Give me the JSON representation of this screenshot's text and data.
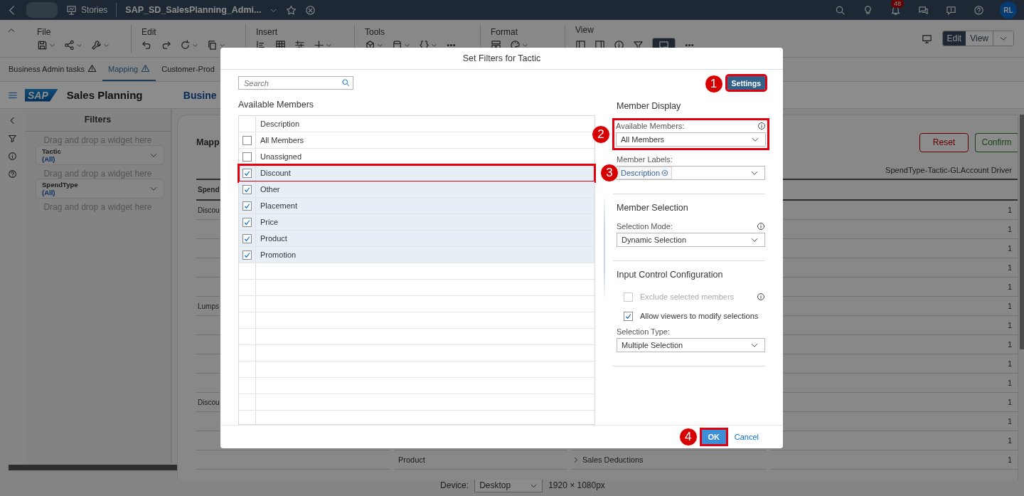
{
  "shell": {
    "section": "Stories",
    "title": "SAP_SD_SalesPlanning_Admi...",
    "notification_count": "48",
    "avatar": "RL"
  },
  "toolbar": {
    "groups": [
      "File",
      "Edit",
      "Insert",
      "Tools",
      "Format",
      "View"
    ],
    "modes": [
      {
        "label": "Edit",
        "selected": true
      },
      {
        "label": "View",
        "selected": false
      }
    ]
  },
  "page_tabs": [
    {
      "label": "Business Admin tasks",
      "selected": false,
      "warning": true
    },
    {
      "label": "Mapping",
      "selected": true,
      "warning": true
    },
    {
      "label": "Customer-Prod",
      "selected": false,
      "warning": false
    }
  ],
  "header": {
    "logo": "SAP",
    "app_title": "Sales Planning",
    "page_title": "Busine"
  },
  "filters": {
    "title": "Filters",
    "items": [
      {
        "kind": "hint",
        "text": "Drag and drop a widget here"
      },
      {
        "kind": "filter",
        "label": "Tactic",
        "value": "(All)"
      },
      {
        "kind": "hint",
        "text": "Drag and drop a widget here"
      },
      {
        "kind": "filter",
        "label": "SpendType",
        "value": "(All)"
      },
      {
        "kind": "hint",
        "text": "Drag and drop a widget here"
      }
    ]
  },
  "content": {
    "title": "Mapp",
    "buttons": [
      {
        "label": "Reset",
        "kind": "reset"
      },
      {
        "label": "Confirm",
        "kind": "confirm"
      }
    ],
    "driver_header": "SpendType-Tactic-GLAccount Driver",
    "column_header": "Spend",
    "rows": [
      {
        "column_1": "Discou",
        "value": "1"
      },
      {
        "value": "1"
      },
      {
        "value": "1"
      },
      {
        "value": "1"
      },
      {
        "value": "1"
      },
      {
        "column_1": "Lumps",
        "value": "1"
      },
      {
        "value": "1"
      },
      {
        "value": "1"
      },
      {
        "value": "1"
      },
      {
        "value": "1"
      },
      {
        "column_1": "Discou",
        "value": "1"
      },
      {
        "value": "1"
      },
      {
        "value": "1"
      },
      {
        "column_2": "Product",
        "column_3": "Sales Deductions",
        "value": "1"
      }
    ]
  },
  "device_bar": {
    "label": "Device:",
    "device": "Desktop",
    "resolution": "1920 × 1080px"
  },
  "dialog": {
    "title": "Set Filters for Tactic",
    "search": {
      "placeholder": "Search"
    },
    "settings": {
      "label": "Settings",
      "callout": "1"
    },
    "members_title": "Available Members",
    "column": "Description",
    "members": [
      {
        "label": "All Members",
        "checked": false
      },
      {
        "label": "Unassigned",
        "checked": false
      },
      {
        "label": "Discount",
        "checked": true,
        "callout": "3"
      },
      {
        "label": "Other",
        "checked": true
      },
      {
        "label": "Placement",
        "checked": true
      },
      {
        "label": "Price",
        "checked": true
      },
      {
        "label": "Product",
        "checked": true
      },
      {
        "label": "Promotion",
        "checked": true
      }
    ],
    "sections": [
      {
        "title": "Member Display",
        "items": [
          {
            "kind": "select",
            "label": "Available Members:",
            "value": "All Members",
            "info": true,
            "callout": "2"
          },
          {
            "kind": "tokens",
            "label": "Member Labels:",
            "tokens": [
              "Description"
            ]
          }
        ]
      },
      {
        "title": "Member Selection",
        "items": [
          {
            "kind": "select",
            "label": "Selection Mode:",
            "value": "Dynamic Selection",
            "info": true
          }
        ]
      },
      {
        "title": "Input Control Configuration",
        "items": [
          {
            "kind": "checkbox",
            "label": "Exclude selected members",
            "checked": false,
            "disabled": true,
            "info": true
          },
          {
            "kind": "checkbox",
            "label": "Allow viewers to modify selections",
            "checked": true,
            "disabled": false
          },
          {
            "kind": "select",
            "label": "Selection Type:",
            "value": "Multiple Selection"
          }
        ]
      }
    ],
    "buttons": [
      {
        "label": "OK",
        "kind": "primary",
        "callout": "4"
      },
      {
        "label": "Cancel",
        "kind": "link"
      }
    ]
  }
}
